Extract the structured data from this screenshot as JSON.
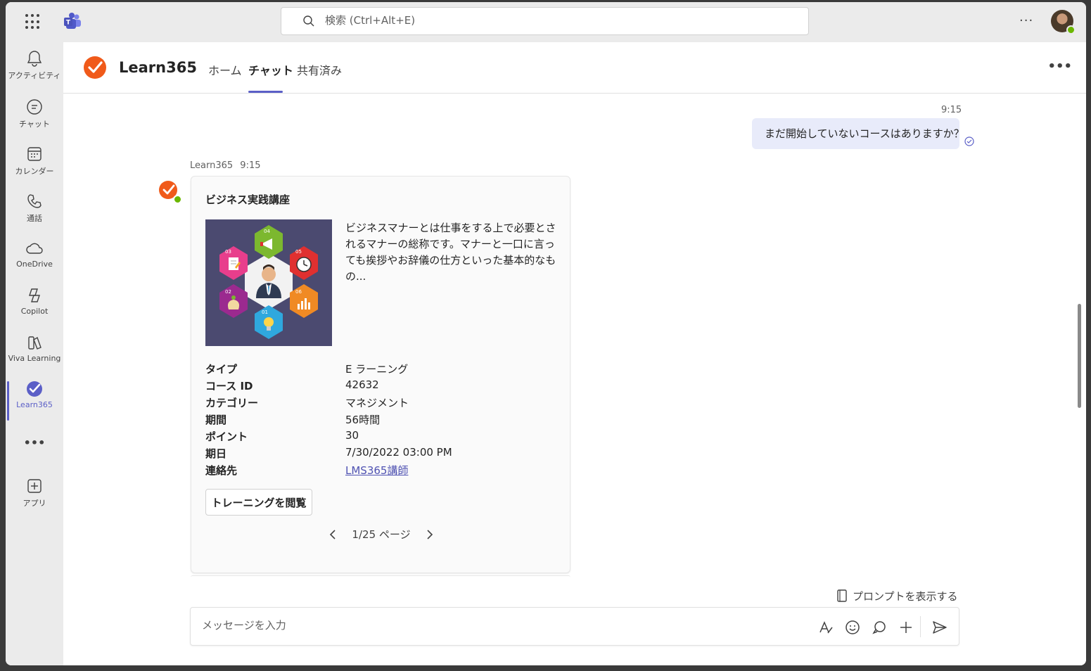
{
  "titlebar": {
    "search_placeholder": "検索 (Ctrl+Alt+E)",
    "icons": [
      "app-launcher-icon",
      "teams-logo-icon",
      "search-icon",
      "more-options-icon",
      "user-avatar"
    ]
  },
  "rail": {
    "items": [
      {
        "label": "アクティビティ",
        "icon": "bell-icon"
      },
      {
        "label": "チャット",
        "icon": "chat-icon"
      },
      {
        "label": "カレンダー",
        "icon": "calendar-icon"
      },
      {
        "label": "通話",
        "icon": "phone-icon"
      },
      {
        "label": "OneDrive",
        "icon": "cloud-icon"
      },
      {
        "label": "Copilot",
        "icon": "copilot-icon"
      },
      {
        "label": "Viva Learning",
        "icon": "books-icon"
      },
      {
        "label": "Learn365",
        "icon": "learn365-icon",
        "active": true
      },
      {
        "label": "アプリ",
        "icon": "add-app-icon"
      }
    ],
    "more": "•••"
  },
  "app": {
    "title": "Learn365",
    "tabs": [
      {
        "label": "ホーム"
      },
      {
        "label": "チャット",
        "active": true
      },
      {
        "label": "共有済み"
      }
    ],
    "more": "•••"
  },
  "conversation": {
    "user_message": {
      "time": "9:15",
      "text": "まだ開始していないコースはありますか？"
    },
    "bot_message": {
      "sender": "Learn365",
      "time": "9:15"
    }
  },
  "card": {
    "title": "ビジネス実践講座",
    "description": "ビジネスマナーとは仕事をする上で必要とされるマナーの総称です。マナーと一口に言っても挨拶やお辞儀の仕方といった基本的なもの...",
    "facts": [
      {
        "key": "タイプ",
        "value": "E ラーニング"
      },
      {
        "key": "コース ID",
        "value": "42632"
      },
      {
        "key": "カテゴリー",
        "value": "マネジメント"
      },
      {
        "key": "期間",
        "value": "56時間"
      },
      {
        "key": "ポイント",
        "value": "30"
      },
      {
        "key": "期日",
        "value": "7/30/2022 03:00 PM"
      },
      {
        "key": "連絡先",
        "value": "LMS365講師"
      }
    ],
    "button": "トレーニングを閲覧",
    "pager": "1/25 ページ",
    "hex_labels": [
      "04",
      "03",
      "05",
      "02",
      "06",
      "01"
    ]
  },
  "composer": {
    "prompt_link": "プロンプトを表示する",
    "placeholder": "メッセージを入力"
  },
  "colors": {
    "accent": "#5b5fc7",
    "learn365_orange": "#f05a1a",
    "presence_green": "#6bb700",
    "bubble": "#e8ebfa"
  }
}
